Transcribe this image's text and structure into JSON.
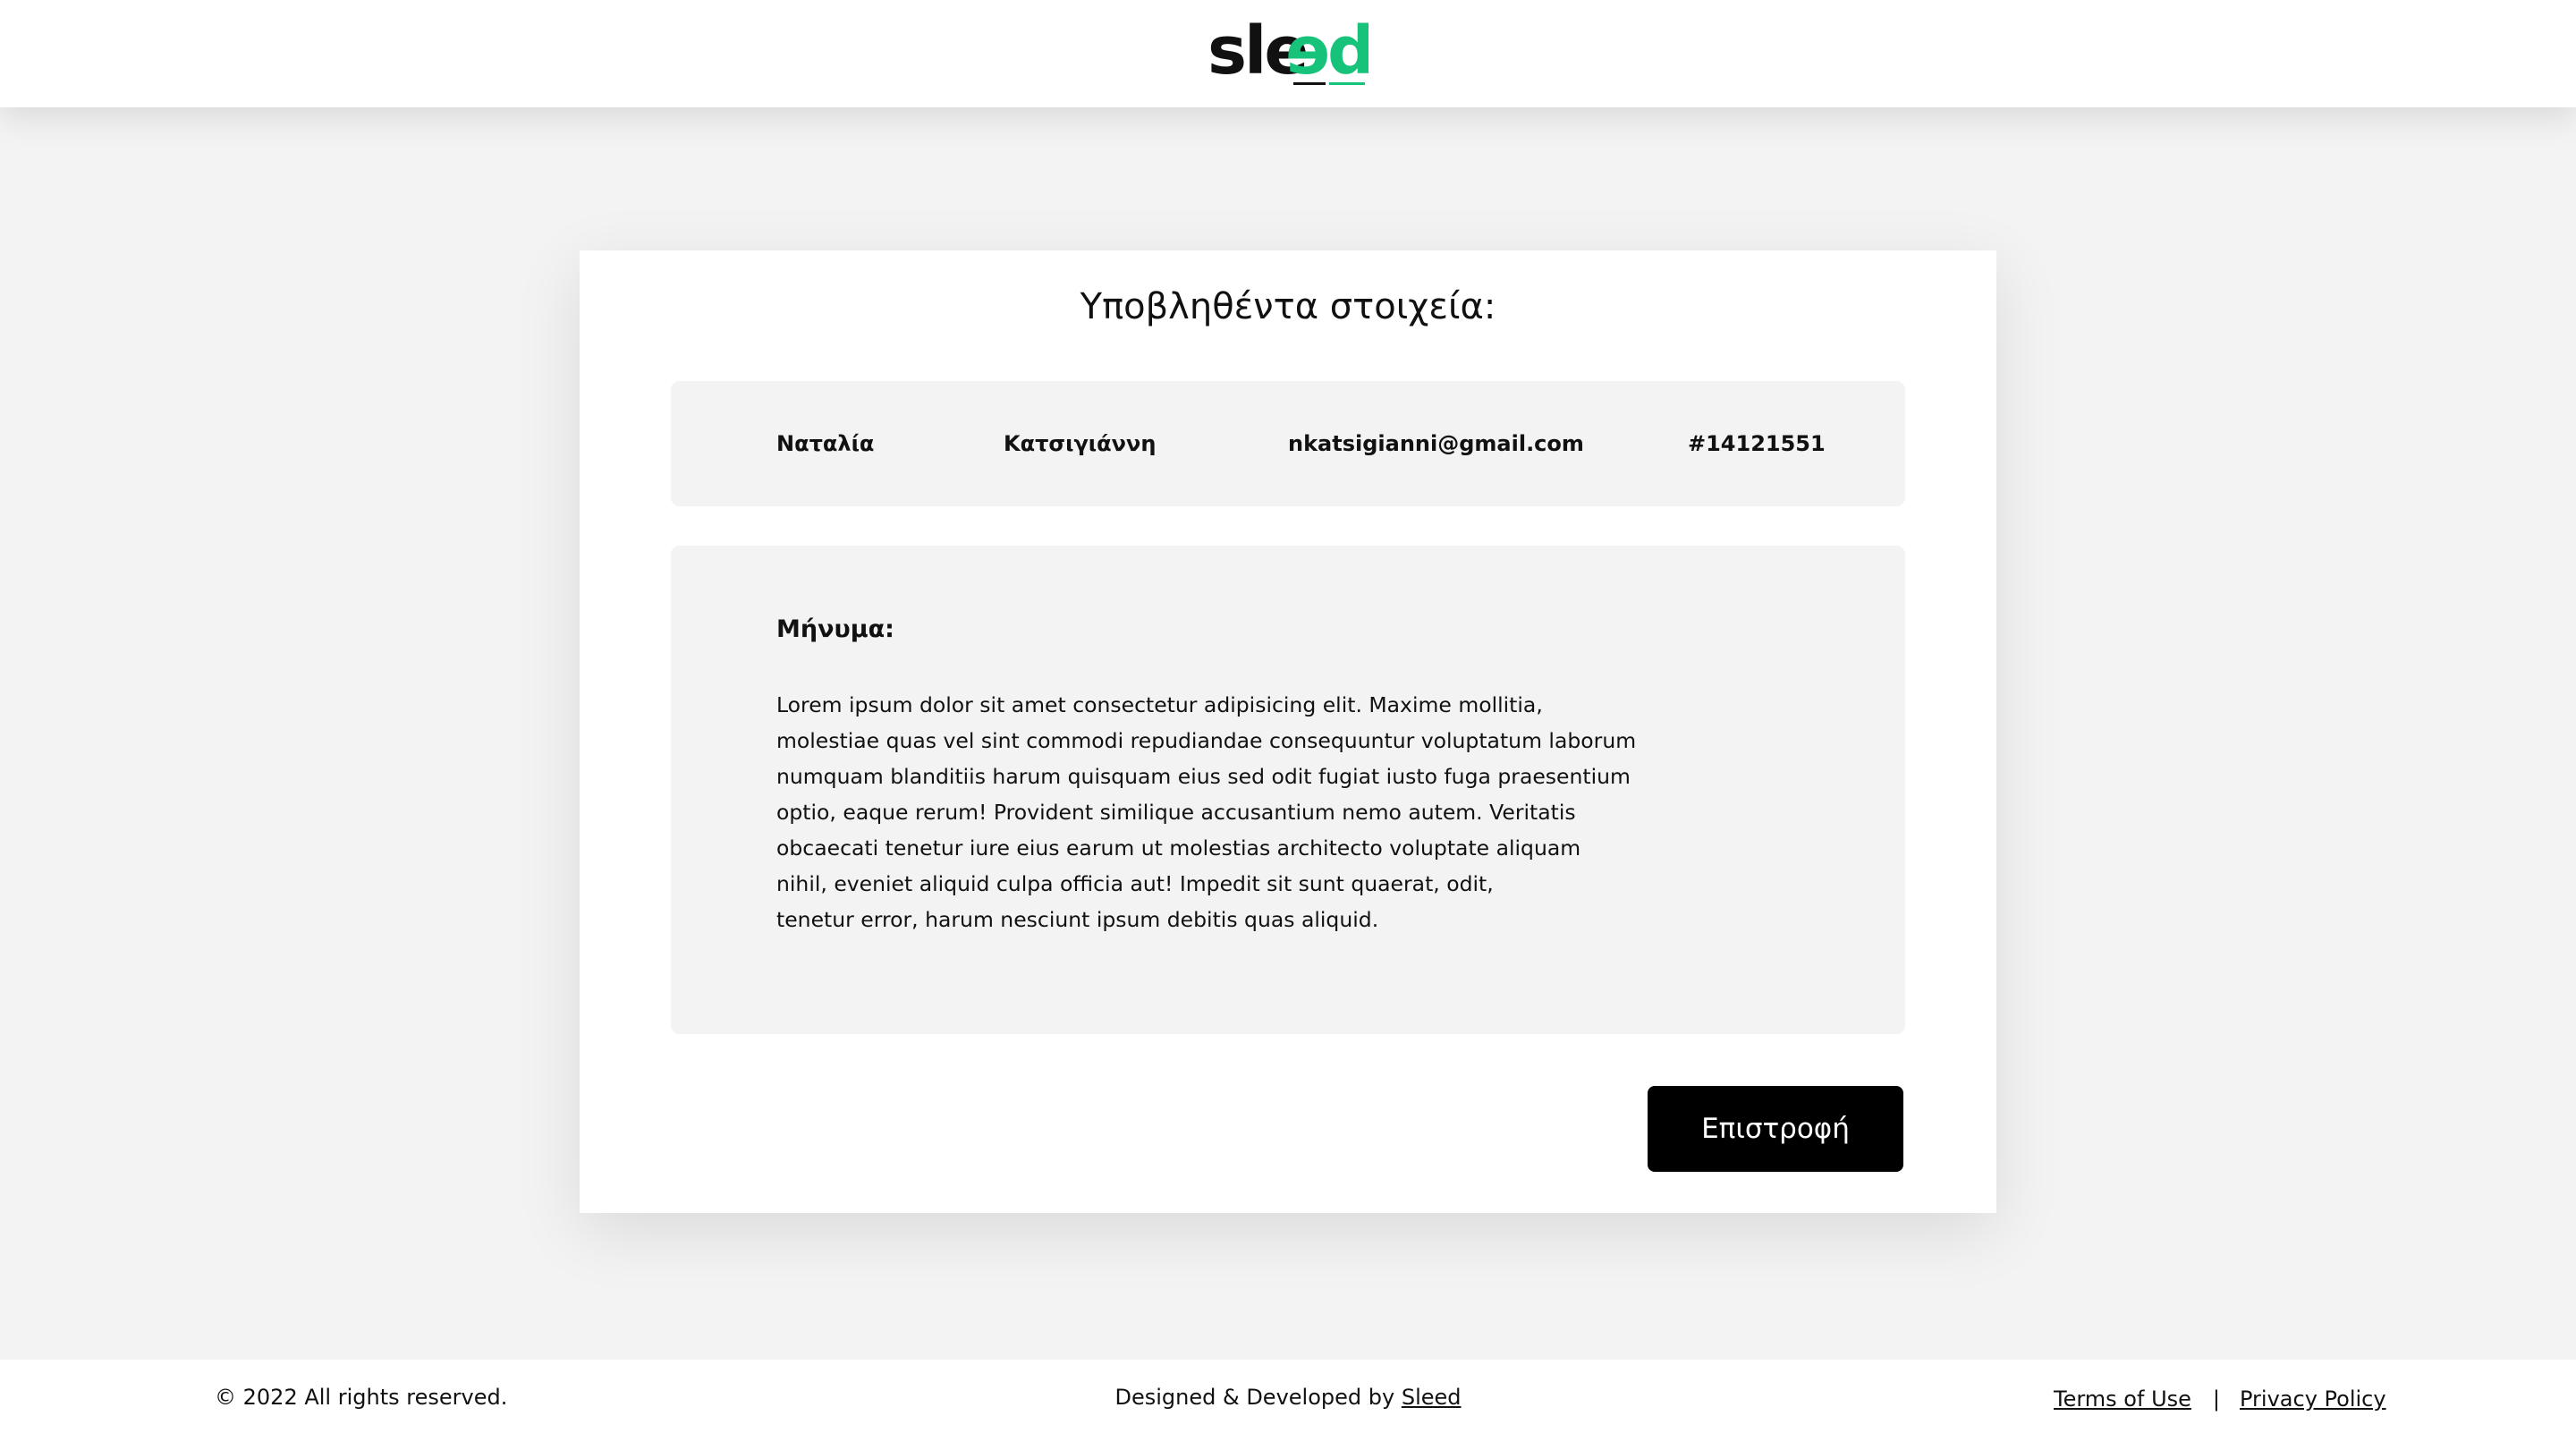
{
  "header": {
    "logo_text": "sleed",
    "logo_colors": {
      "dark": "#111111",
      "accent": "#17c37a"
    }
  },
  "card": {
    "title": "Υποβληθέντα στοιχεία:",
    "submission": {
      "first_name": "Ναταλία",
      "last_name": "Κατσιγιάννη",
      "email": "nkatsigianni@gmail.com",
      "id": "#14121551"
    },
    "message": {
      "label": "Μήνυμα:",
      "lines": [
        "Lorem ipsum dolor sit amet consectetur adipisicing elit. Maxime mollitia,",
        "molestiae quas vel sint commodi repudiandae consequuntur voluptatum laborum",
        "numquam blanditiis harum quisquam eius sed odit fugiat iusto fuga praesentium",
        "optio, eaque rerum! Provident similique accusantium nemo autem. Veritatis",
        "obcaecati tenetur iure eius earum ut molestias architecto voluptate aliquam",
        "nihil, eveniet aliquid culpa officia aut! Impedit sit sunt quaerat, odit,",
        "tenetur error, harum nesciunt ipsum debitis quas aliquid."
      ]
    },
    "back_button_label": "Επιστροφή"
  },
  "footer": {
    "copyright": "© 2022 All rights reserved.",
    "credits_prefix": "Designed & Developed by ",
    "credits_link": "Sleed",
    "terms_link": "Terms of Use",
    "separator": "|",
    "privacy_link": "Privacy Policy"
  }
}
